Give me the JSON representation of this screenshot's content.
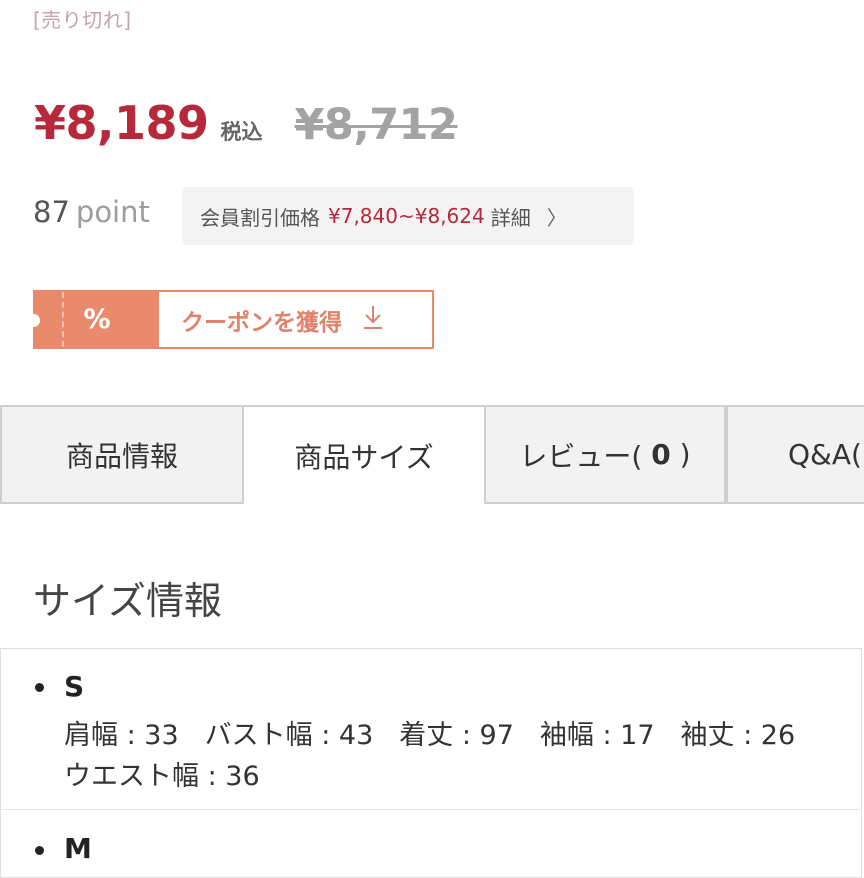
{
  "status": {
    "soldout": "[売り切れ]"
  },
  "price": {
    "current": "¥8,189",
    "tax_label": "税込",
    "original": "¥8,712"
  },
  "points": {
    "value": "87",
    "unit": "point"
  },
  "member_price": {
    "label": "会員割引価格",
    "range": "¥7,840~¥8,624",
    "detail": "詳細",
    "chevron": "〉"
  },
  "coupon": {
    "percent_icon": "%",
    "label": "クーポンを獲得",
    "icon": "download-icon",
    "accent": "#ea8a6c"
  },
  "tabs": [
    {
      "label": "商品情報"
    },
    {
      "label": "商品サイズ",
      "active": true
    },
    {
      "label": "レビュー(",
      "count": "0",
      "close": ")"
    },
    {
      "label": "Q&A("
    }
  ],
  "size_section": {
    "title": "サイズ情報",
    "sizes": [
      {
        "name": "S",
        "line1": [
          {
            "text": "肩幅 : 33"
          },
          {
            "text": "バスト幅 : 43"
          },
          {
            "text": "着丈 : 97"
          },
          {
            "text": "袖幅 : 17"
          },
          {
            "text": "袖丈 : 26"
          }
        ],
        "line2": [
          {
            "text": "ウエスト幅 : 36"
          }
        ]
      },
      {
        "name": "M"
      }
    ]
  },
  "colors": {
    "price_red": "#b7283a",
    "soldout_pink": "#c8a1ad",
    "coupon_orange": "#ea8a6c"
  }
}
